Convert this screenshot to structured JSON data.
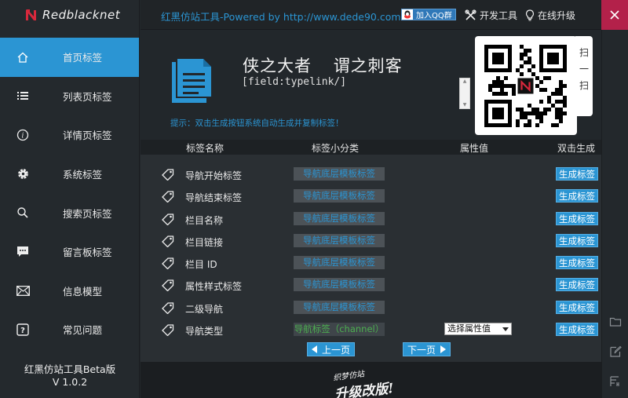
{
  "brand": {
    "name": "Redblacknet"
  },
  "topbar": {
    "title": "红黑仿站工具-Powered by http://www.dede90.com",
    "qq_label": "加入QQ群",
    "dev_tool": "开发工具",
    "upgrade": "在线升级"
  },
  "sidebar": {
    "items": [
      {
        "label": "首页标签",
        "icon": "home-icon",
        "active": true
      },
      {
        "label": "列表页标签",
        "icon": "list-icon"
      },
      {
        "label": "详情页标签",
        "icon": "info-icon"
      },
      {
        "label": "系统标签",
        "icon": "gear-icon"
      },
      {
        "label": "搜索页标签",
        "icon": "search-icon"
      },
      {
        "label": "留言板标签",
        "icon": "chat-icon"
      },
      {
        "label": "信息模型",
        "icon": "mail-icon"
      },
      {
        "label": "常见问题",
        "icon": "help-icon"
      }
    ],
    "footer_line1": "红黑仿站工具Beta版",
    "footer_line2": "V 1.0.2"
  },
  "hero": {
    "title_a": "侠之大者",
    "title_b": "谓之刺客",
    "input_value": "[field:typelink/]",
    "hint": "提示：双击生成按钮系统自动生成并复制标签！",
    "qr_tab_1": "扫",
    "qr_tab_2": "一",
    "qr_tab_3": "扫"
  },
  "table": {
    "headers": {
      "name": "标签名称",
      "category": "标签小分类",
      "attribute": "属性值",
      "generate": "双击生成"
    },
    "rows": [
      {
        "name": "导航开始标签",
        "category": "导航底层模板标签",
        "generate": "生成标签"
      },
      {
        "name": "导航结束标签",
        "category": "导航底层模板标签",
        "generate": "生成标签"
      },
      {
        "name": "栏目名称",
        "category": "导航底层模板标签",
        "generate": "生成标签"
      },
      {
        "name": "栏目链接",
        "category": "导航底层模板标签",
        "generate": "生成标签"
      },
      {
        "name": "栏目 ID",
        "category": "导航底层模板标签",
        "generate": "生成标签"
      },
      {
        "name": "属性样式标签",
        "category": "导航底层模板标签",
        "generate": "生成标签"
      },
      {
        "name": "二级导航",
        "category": "导航底层模板标签",
        "generate": "生成标签"
      },
      {
        "name": "导航类型",
        "category": "导航标签（channel）",
        "attribute": "选择属性值",
        "generate": "生成标签"
      }
    ]
  },
  "pager": {
    "prev": "上一页",
    "next": "下一页"
  },
  "banner": {
    "line1": "织梦仿站",
    "line2": "升级改版!"
  },
  "colors": {
    "accent": "#2b95d3",
    "close": "#b3214a",
    "green": "#4caf50"
  }
}
